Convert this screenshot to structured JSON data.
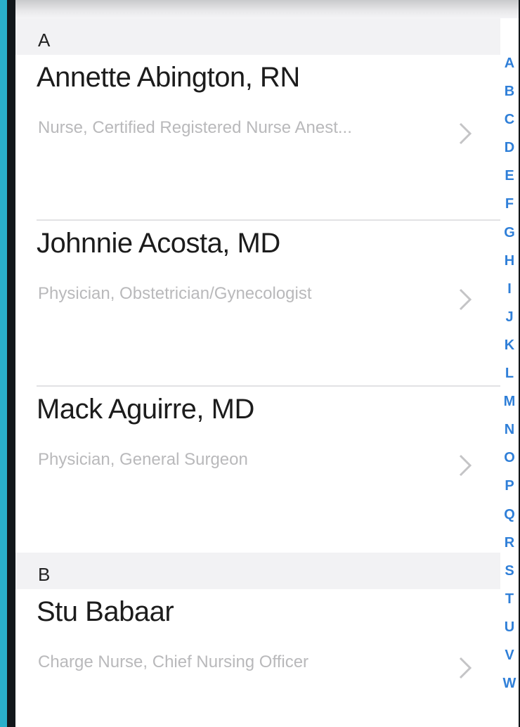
{
  "sections": [
    {
      "header": "A",
      "rows": [
        {
          "name": "Annette Abington, RN",
          "subtitle": "Nurse, Certified Registered Nurse Anest..."
        },
        {
          "name": "Johnnie Acosta, MD",
          "subtitle": "Physician, Obstetrician/Gynecologist"
        },
        {
          "name": "Mack Aguirre, MD",
          "subtitle": "Physician, General Surgeon"
        }
      ]
    },
    {
      "header": "B",
      "rows": [
        {
          "name": "Stu Babaar",
          "subtitle": "Charge Nurse, Chief Nursing Officer"
        }
      ]
    }
  ],
  "index_letters": [
    "A",
    "B",
    "C",
    "D",
    "E",
    "F",
    "G",
    "H",
    "I",
    "J",
    "K",
    "L",
    "M",
    "N",
    "O",
    "P",
    "Q",
    "R",
    "S",
    "T",
    "U",
    "V",
    "W"
  ],
  "icons": {
    "row_accessory": "chevron-right-icon"
  },
  "colors": {
    "index_blue": "#2f7fd8",
    "frame": "#2ab0cb",
    "section_header_bg": "#f2f2f4"
  }
}
